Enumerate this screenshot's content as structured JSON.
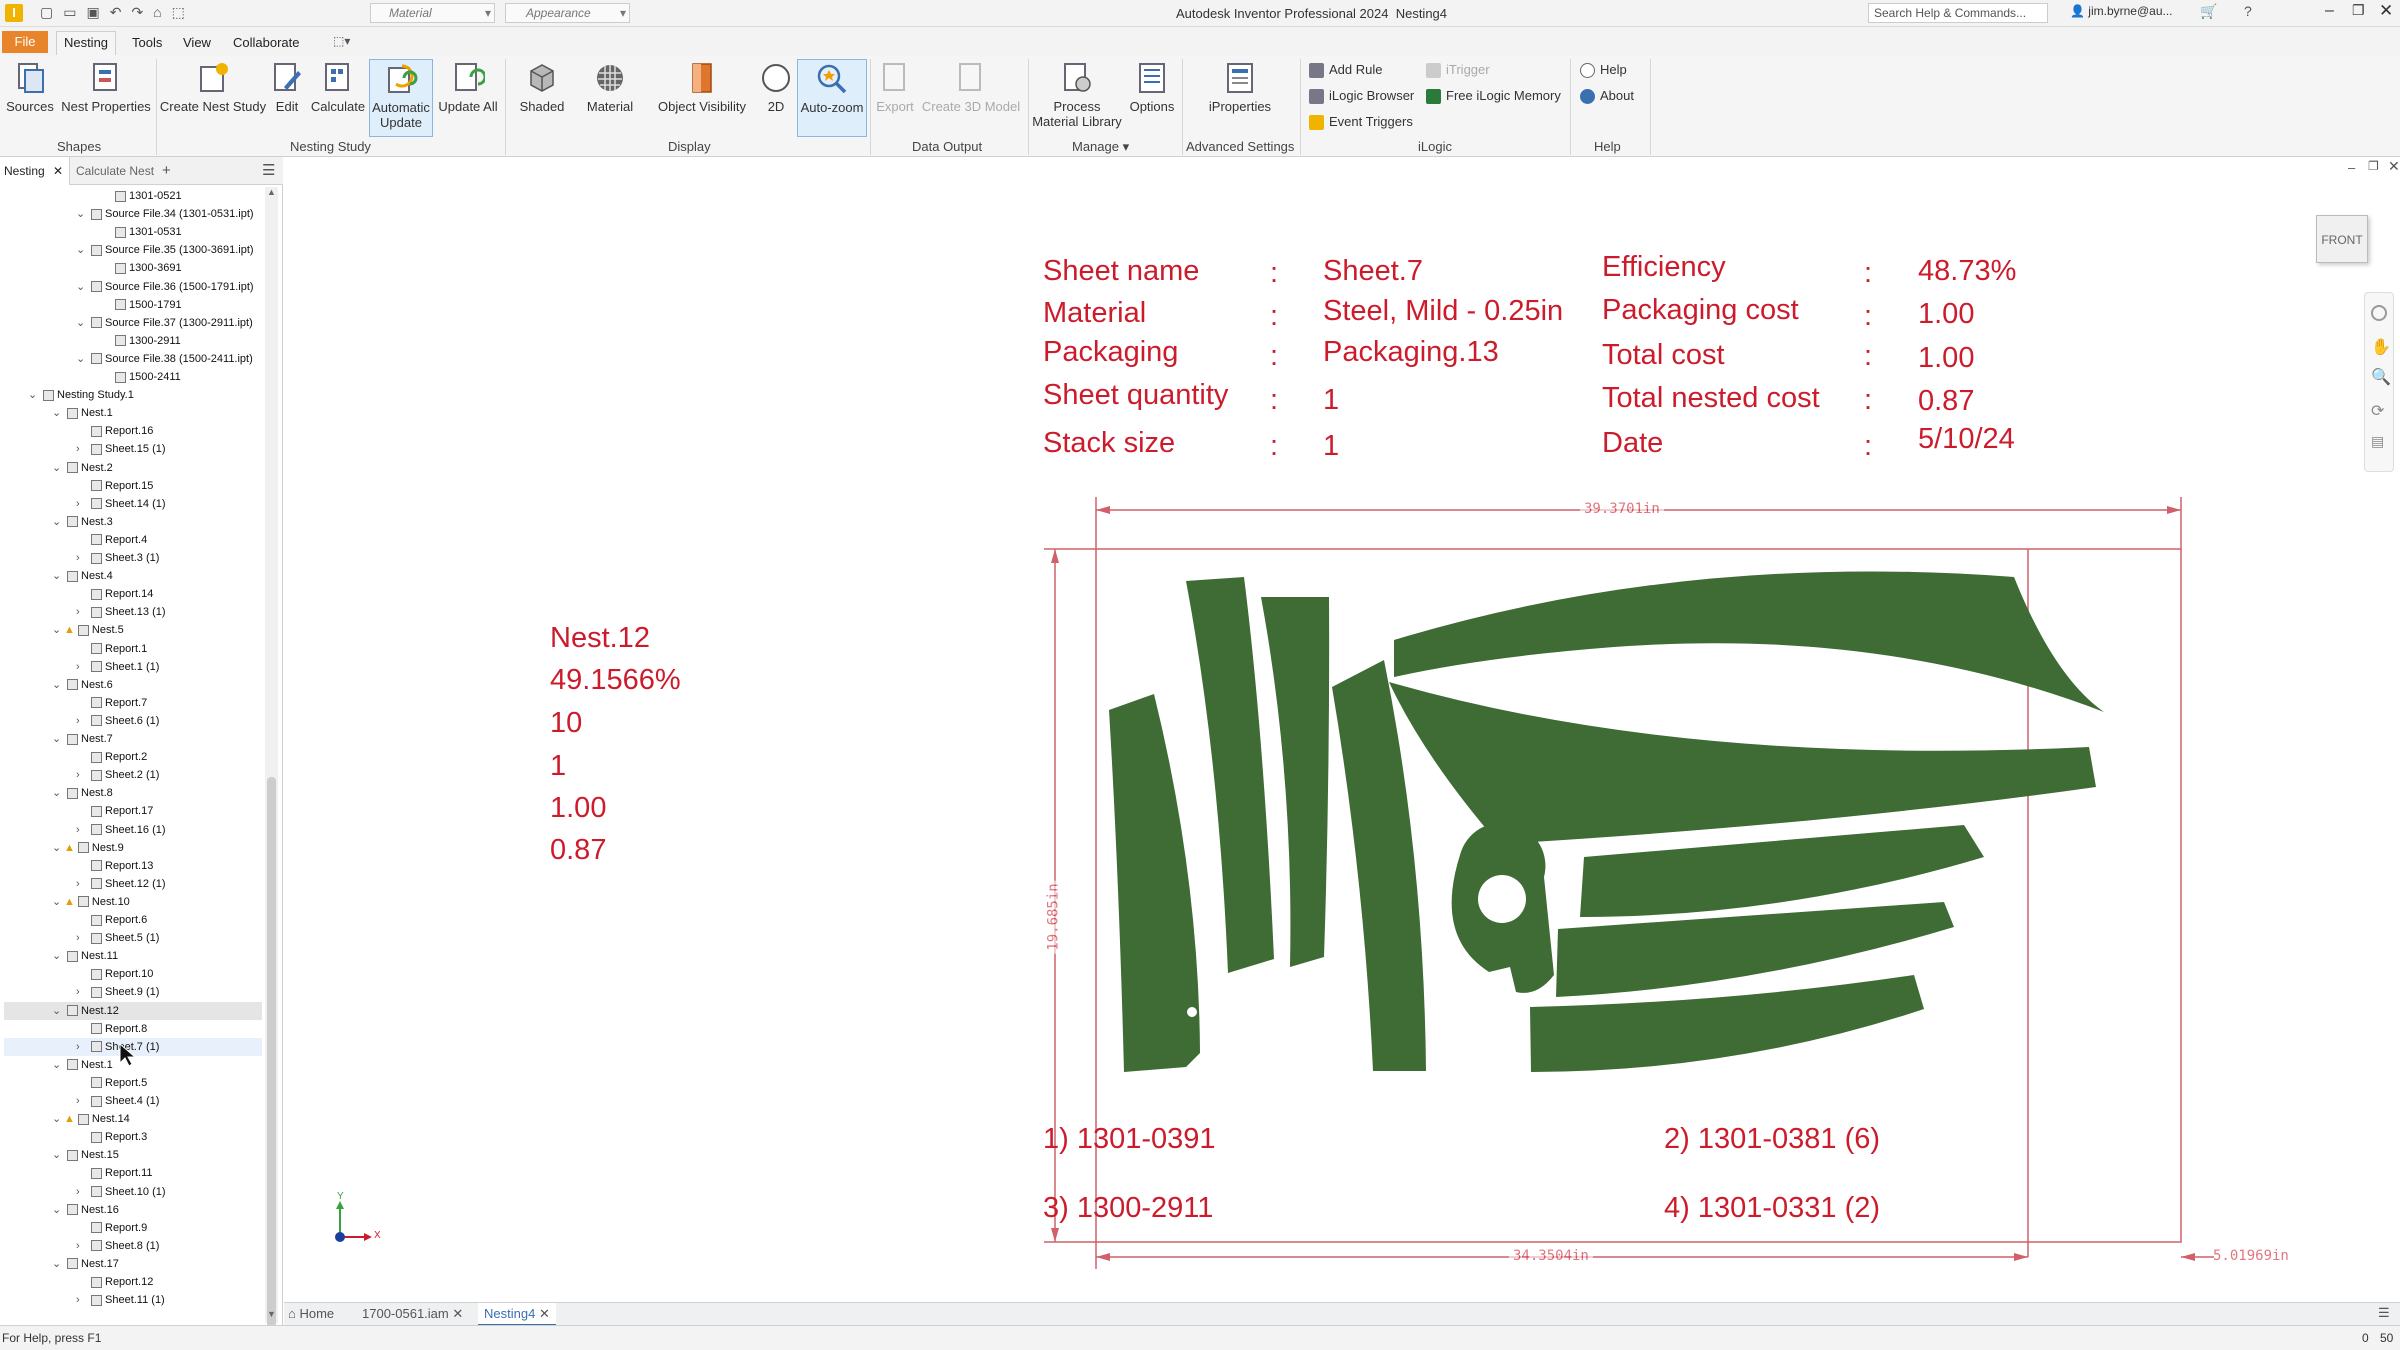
{
  "window": {
    "title": "Autodesk Inventor Professional 2024",
    "document": "Nesting4",
    "quick_material": "Material",
    "quick_appearance": "Appearance",
    "search_placeholder": "Search Help & Commands...",
    "user": "jim.byrne@au..."
  },
  "menu_tabs": [
    "File",
    "Nesting",
    "Tools",
    "View",
    "Collaborate"
  ],
  "ribbon": {
    "sources": "Sources",
    "nest_properties": "Nest Properties",
    "create_nest_study": "Create Nest Study",
    "edit": "Edit",
    "calculate": "Calculate",
    "automatic_update": "Automatic Update",
    "update_all": "Update All",
    "shaded": "Shaded",
    "material": "Material",
    "object_visibility": "Object Visibility",
    "two_d": "2D",
    "auto_zoom": "Auto-zoom",
    "export": "Export",
    "create_3d_model": "Create 3D Model",
    "process_material_library": "Process Material Library",
    "options": "Options",
    "iproperties": "iProperties",
    "add_rule": "Add Rule",
    "ilogic_browser": "iLogic Browser",
    "event_triggers": "Event Triggers",
    "itrigger": "iTrigger",
    "free_ilogic_memory": "Free iLogic Memory",
    "help": "Help",
    "about": "About",
    "panels": {
      "shapes": "Shapes",
      "nesting_study": "Nesting Study",
      "display": "Display",
      "data_output": "Data Output",
      "manage": "Manage",
      "advanced_settings": "Advanced Settings",
      "ilogic": "iLogic",
      "help": "Help"
    }
  },
  "browser": {
    "tab_nesting": "Nesting",
    "tab_calculate": "Calculate Nest",
    "tree": [
      {
        "label": "1301-0521",
        "indent": 5,
        "chev": ""
      },
      {
        "label": "Source File.34 (1301-0531.ipt)",
        "indent": 4,
        "chev": "v"
      },
      {
        "label": "1301-0531",
        "indent": 5,
        "chev": ""
      },
      {
        "label": "Source File.35 (1300-3691.ipt)",
        "indent": 4,
        "chev": "v"
      },
      {
        "label": "1300-3691",
        "indent": 5,
        "chev": ""
      },
      {
        "label": "Source File.36 (1500-1791.ipt)",
        "indent": 4,
        "chev": "v"
      },
      {
        "label": "1500-1791",
        "indent": 5,
        "chev": ""
      },
      {
        "label": "Source File.37 (1300-2911.ipt)",
        "indent": 4,
        "chev": "v"
      },
      {
        "label": "1300-2911",
        "indent": 5,
        "chev": ""
      },
      {
        "label": "Source File.38 (1500-2411.ipt)",
        "indent": 4,
        "chev": "v"
      },
      {
        "label": "1500-2411",
        "indent": 5,
        "chev": ""
      },
      {
        "label": "Nesting Study.1",
        "indent": 1,
        "chev": "v"
      },
      {
        "label": "Nest.1",
        "indent": 2,
        "chev": "v"
      },
      {
        "label": "Report.16",
        "indent": 3,
        "chev": ""
      },
      {
        "label": "Sheet.15 (1)",
        "indent": 3,
        "chev": ">"
      },
      {
        "label": "Nest.2",
        "indent": 2,
        "chev": "v"
      },
      {
        "label": "Report.15",
        "indent": 3,
        "chev": ""
      },
      {
        "label": "Sheet.14 (1)",
        "indent": 3,
        "chev": ">"
      },
      {
        "label": "Nest.3",
        "indent": 2,
        "chev": "v"
      },
      {
        "label": "Report.4",
        "indent": 3,
        "chev": ""
      },
      {
        "label": "Sheet.3 (1)",
        "indent": 3,
        "chev": ">"
      },
      {
        "label": "Nest.4",
        "indent": 2,
        "chev": "v"
      },
      {
        "label": "Report.14",
        "indent": 3,
        "chev": ""
      },
      {
        "label": "Sheet.13 (1)",
        "indent": 3,
        "chev": ">"
      },
      {
        "label": "Nest.5",
        "indent": 2,
        "chev": "v",
        "warn": true
      },
      {
        "label": "Report.1",
        "indent": 3,
        "chev": ""
      },
      {
        "label": "Sheet.1 (1)",
        "indent": 3,
        "chev": ">"
      },
      {
        "label": "Nest.6",
        "indent": 2,
        "chev": "v"
      },
      {
        "label": "Report.7",
        "indent": 3,
        "chev": ""
      },
      {
        "label": "Sheet.6 (1)",
        "indent": 3,
        "chev": ">"
      },
      {
        "label": "Nest.7",
        "indent": 2,
        "chev": "v"
      },
      {
        "label": "Report.2",
        "indent": 3,
        "chev": ""
      },
      {
        "label": "Sheet.2 (1)",
        "indent": 3,
        "chev": ">"
      },
      {
        "label": "Nest.8",
        "indent": 2,
        "chev": "v"
      },
      {
        "label": "Report.17",
        "indent": 3,
        "chev": ""
      },
      {
        "label": "Sheet.16 (1)",
        "indent": 3,
        "chev": ">"
      },
      {
        "label": "Nest.9",
        "indent": 2,
        "chev": "v",
        "warn": true
      },
      {
        "label": "Report.13",
        "indent": 3,
        "chev": ""
      },
      {
        "label": "Sheet.12 (1)",
        "indent": 3,
        "chev": ">"
      },
      {
        "label": "Nest.10",
        "indent": 2,
        "chev": "v",
        "warn": true
      },
      {
        "label": "Report.6",
        "indent": 3,
        "chev": ""
      },
      {
        "label": "Sheet.5 (1)",
        "indent": 3,
        "chev": ">"
      },
      {
        "label": "Nest.11",
        "indent": 2,
        "chev": "v"
      },
      {
        "label": "Report.10",
        "indent": 3,
        "chev": ""
      },
      {
        "label": "Sheet.9 (1)",
        "indent": 3,
        "chev": ">"
      },
      {
        "label": "Nest.12",
        "indent": 2,
        "chev": "v",
        "selected": true
      },
      {
        "label": "Report.8",
        "indent": 3,
        "chev": ""
      },
      {
        "label": "Sheet.7 (1)",
        "indent": 3,
        "chev": ">",
        "hover": true
      },
      {
        "label": "Nest.1",
        "indent": 2,
        "chev": "v"
      },
      {
        "label": "Report.5",
        "indent": 3,
        "chev": ""
      },
      {
        "label": "Sheet.4 (1)",
        "indent": 3,
        "chev": ">"
      },
      {
        "label": "Nest.14",
        "indent": 2,
        "chev": "v",
        "warn": true
      },
      {
        "label": "Report.3",
        "indent": 3,
        "chev": ""
      },
      {
        "label": "Nest.15",
        "indent": 2,
        "chev": "v"
      },
      {
        "label": "Report.11",
        "indent": 3,
        "chev": ""
      },
      {
        "label": "Sheet.10 (1)",
        "indent": 3,
        "chev": ">"
      },
      {
        "label": "Nest.16",
        "indent": 2,
        "chev": "v"
      },
      {
        "label": "Report.9",
        "indent": 3,
        "chev": ""
      },
      {
        "label": "Sheet.8 (1)",
        "indent": 3,
        "chev": ">"
      },
      {
        "label": "Nest.17",
        "indent": 2,
        "chev": "v"
      },
      {
        "label": "Report.12",
        "indent": 3,
        "chev": ""
      },
      {
        "label": "Sheet.11 (1)",
        "indent": 3,
        "chev": ">"
      }
    ]
  },
  "nest_summary": [
    "Nest.12",
    "49.1566%",
    "10",
    "1",
    "1.00",
    "0.87"
  ],
  "sheet_info": {
    "left": [
      {
        "label": "Sheet name",
        "value": "Sheet.7"
      },
      {
        "label": "Material",
        "value": "Steel, Mild - 0.25in"
      },
      {
        "label": "Packaging",
        "value": "Packaging.13"
      },
      {
        "label": "Sheet quantity",
        "value": "1"
      },
      {
        "label": "Stack size",
        "value": "1"
      }
    ],
    "right": [
      {
        "label": "Efficiency",
        "value": "48.73%"
      },
      {
        "label": "Packaging cost",
        "value": "1.00"
      },
      {
        "label": "Total cost",
        "value": "1.00"
      },
      {
        "label": "Total nested cost",
        "value": "0.87"
      },
      {
        "label": "Date",
        "value": "5/10/24"
      }
    ],
    "colon": ":"
  },
  "dimensions": {
    "width": "39.3701in",
    "height": "19.685in",
    "used": "34.3504in",
    "remaining": "5.01969in"
  },
  "parts": [
    "1) 1301-0391",
    "2) 1301-0381 (6)",
    "3) 1300-2911",
    "4) 1301-0331 (2)"
  ],
  "viewcube": "FRONT",
  "axes": {
    "x": "X",
    "y": "Y"
  },
  "doc_tabs": [
    "Home",
    "1700-0561.iam",
    "Nesting4"
  ],
  "status": {
    "hint": "For Help, press F1",
    "count_a": "0",
    "count_b": "50"
  },
  "colors": {
    "accent_red": "#cc1c2c",
    "part_green": "#3f6b35",
    "file_tab": "#e8842a"
  }
}
